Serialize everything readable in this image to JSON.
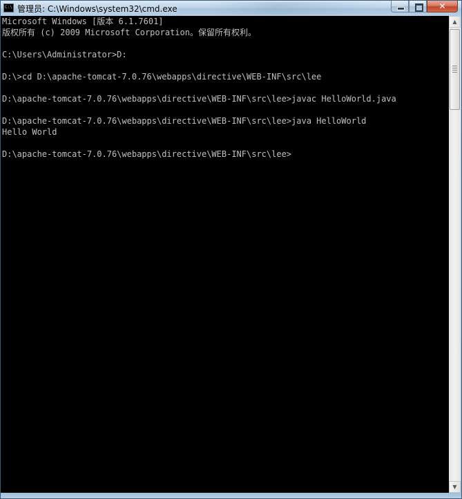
{
  "window": {
    "title": "管理员: C:\\Windows\\system32\\cmd.exe",
    "icon": "cmd-icon",
    "icon_text": "C:\\",
    "minimize_icon": "minimize-icon",
    "maximize_icon": "maximize-icon",
    "close_icon": "close-icon",
    "close_glyph": "✕"
  },
  "console": {
    "background": "#000000",
    "foreground": "#c0c0c0",
    "lines": [
      "Microsoft Windows [版本 6.1.7601]",
      "版权所有 (c) 2009 Microsoft Corporation。保留所有权利。",
      "",
      "C:\\Users\\Administrator>D:",
      "",
      "D:\\>cd D:\\apache-tomcat-7.0.76\\webapps\\directive\\WEB-INF\\src\\lee",
      "",
      "D:\\apache-tomcat-7.0.76\\webapps\\directive\\WEB-INF\\src\\lee>javac HelloWorld.java",
      "",
      "D:\\apache-tomcat-7.0.76\\webapps\\directive\\WEB-INF\\src\\lee>java HelloWorld",
      "Hello World",
      "",
      "D:\\apache-tomcat-7.0.76\\webapps\\directive\\WEB-INF\\src\\lee>"
    ]
  },
  "scrollbar": {
    "up_glyph": "▲",
    "down_glyph": "▼"
  }
}
